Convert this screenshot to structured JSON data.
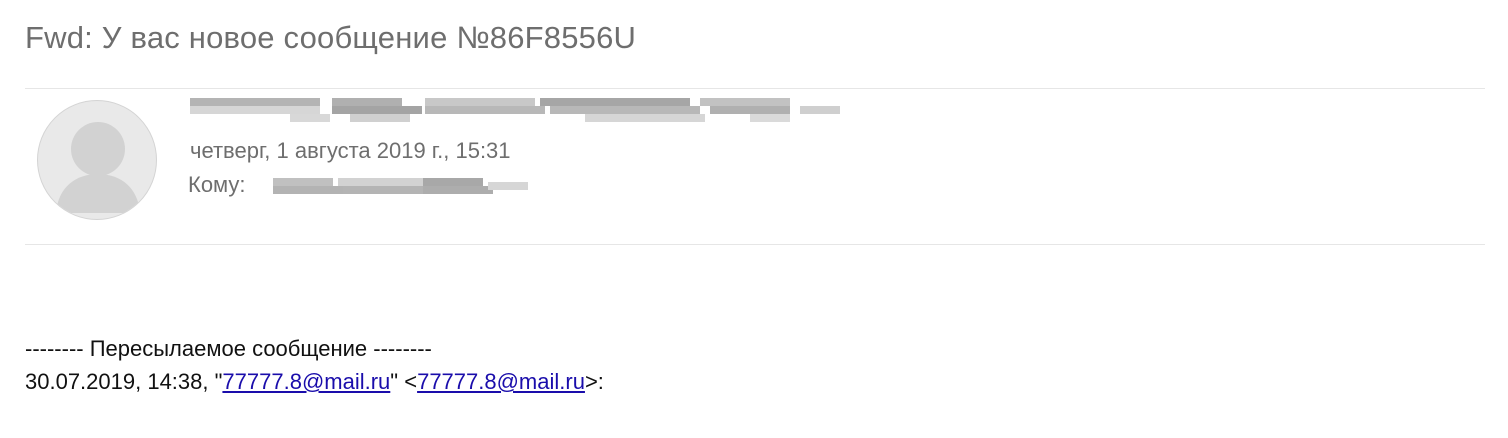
{
  "email": {
    "subject": "Fwd: У вас новое сообщение №86F8556U",
    "avatar_icon": "person-silhouette-icon",
    "date_line": "четверг, 1 августа 2019 г., 15:31",
    "to_label": "Кому:"
  },
  "forwarded": {
    "header": "-------- Пересылаемое сообщение --------",
    "meta_prefix": "30.07.2019, 14:38, \"",
    "from_email": "77777.8@mail.ru",
    "meta_middle": "\" <",
    "from_email_angle": "77777.8@mail.ru",
    "meta_suffix": ">:"
  },
  "colors": {
    "link": "#1a0dab",
    "subject_text": "#6e6e6e",
    "divider": "#e6e6e6"
  }
}
